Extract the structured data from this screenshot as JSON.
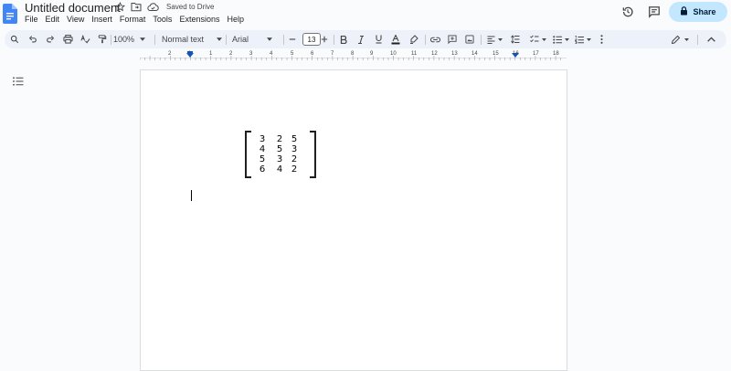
{
  "document": {
    "title": "Untitled document",
    "save_status": "Saved to Drive"
  },
  "menu": [
    "File",
    "Edit",
    "View",
    "Insert",
    "Format",
    "Tools",
    "Extensions",
    "Help"
  ],
  "share": {
    "label": "Share"
  },
  "toolbar": {
    "zoom": "100%",
    "style": "Normal text",
    "font": "Arial",
    "font_size": "13"
  },
  "ruler": {
    "labels": [
      "2",
      "1",
      "1",
      "2",
      "3",
      "4",
      "5",
      "6",
      "7",
      "8",
      "9",
      "10",
      "11",
      "12",
      "13",
      "14",
      "15",
      "16",
      "17",
      "18"
    ]
  },
  "matrix": {
    "rows": [
      [
        "3",
        "2",
        "5"
      ],
      [
        "4",
        "5",
        "3"
      ],
      [
        "5",
        "3",
        "2"
      ],
      [
        "6",
        "4",
        "2"
      ]
    ]
  },
  "colors": {
    "accent": "#0b57d0",
    "share_bg": "#c2e7ff",
    "toolbar_bg": "#edf2fa",
    "docs_blue": "#4285f4"
  }
}
